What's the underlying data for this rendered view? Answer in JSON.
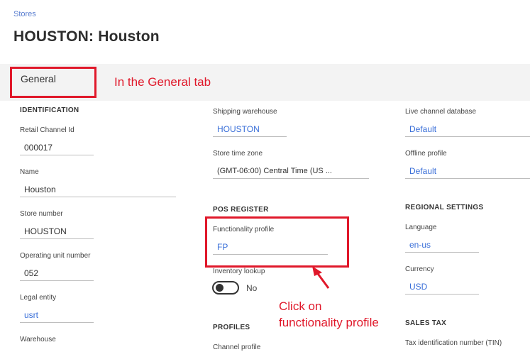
{
  "breadcrumb": "Stores",
  "page_title": "HOUSTON: Houston",
  "tabs": {
    "general": "General"
  },
  "annotations": {
    "general_tab": "In the General tab",
    "click_line1": "Click on",
    "click_line2": "functionality profile"
  },
  "identification": {
    "heading": "IDENTIFICATION",
    "retail_channel_id": {
      "label": "Retail Channel Id",
      "value": "000017"
    },
    "name": {
      "label": "Name",
      "value": "Houston"
    },
    "store_number": {
      "label": "Store number",
      "value": "HOUSTON"
    },
    "operating_unit_number": {
      "label": "Operating unit number",
      "value": "052"
    },
    "legal_entity": {
      "label": "Legal entity",
      "value": "usrt"
    },
    "warehouse": {
      "label": "Warehouse"
    }
  },
  "middle": {
    "shipping_warehouse": {
      "label": "Shipping warehouse",
      "value": "HOUSTON"
    },
    "store_time_zone": {
      "label": "Store time zone",
      "value": "(GMT-06:00) Central Time (US ..."
    },
    "pos_register_heading": "POS REGISTER",
    "functionality_profile": {
      "label": "Functionality profile",
      "value": "FP"
    },
    "inventory_lookup": {
      "label": "Inventory lookup",
      "toggle": "No"
    },
    "profiles_heading": "PROFILES",
    "channel_profile": {
      "label": "Channel profile"
    }
  },
  "right": {
    "live_channel_database": {
      "label": "Live channel database",
      "value": "Default"
    },
    "offline_profile": {
      "label": "Offline profile",
      "value": "Default"
    },
    "regional_heading": "REGIONAL SETTINGS",
    "language": {
      "label": "Language",
      "value": "en-us"
    },
    "currency": {
      "label": "Currency",
      "value": "USD"
    },
    "sales_tax_heading": "SALES TAX",
    "tax_id": {
      "label": "Tax identification number (TIN)"
    }
  },
  "colors": {
    "accent_link": "#3a6fd8",
    "annotation_red": "#e0182a"
  }
}
